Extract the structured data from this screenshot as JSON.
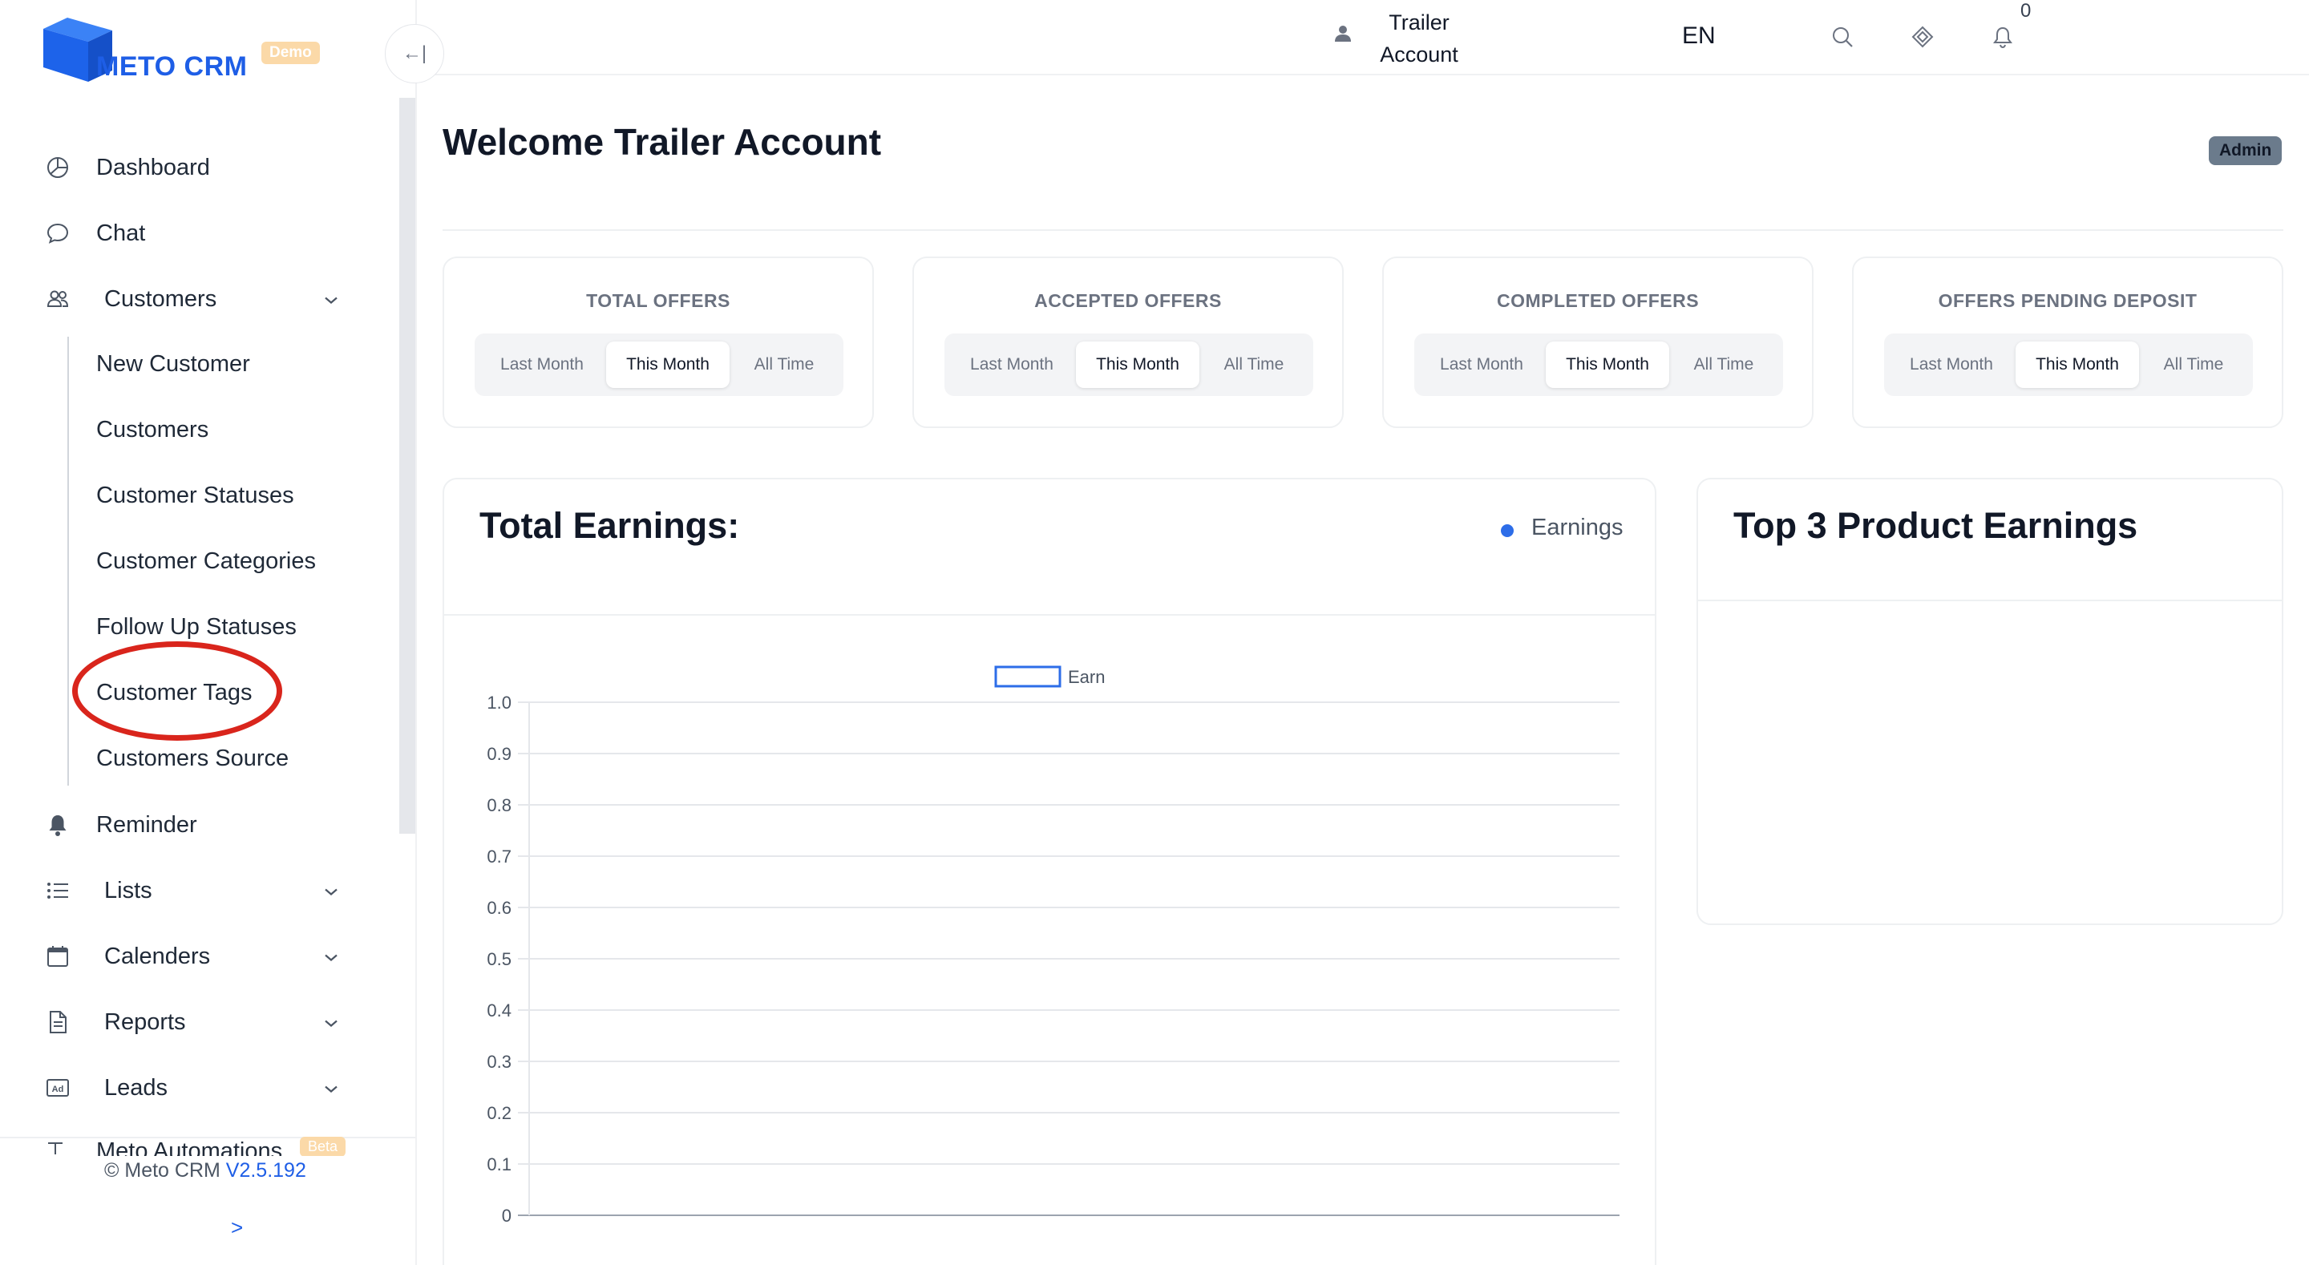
{
  "brand": {
    "name": "METO CRM",
    "badge": "Demo"
  },
  "sidebar": {
    "items": [
      {
        "label": "Dashboard",
        "icon": "pie-chart-icon"
      },
      {
        "label": "Chat",
        "icon": "chat-bubble-icon"
      },
      {
        "label": "Customers",
        "icon": "users-icon",
        "expanded": true
      },
      {
        "label": "Reminder",
        "icon": "bell-filled-icon"
      },
      {
        "label": "Lists",
        "icon": "list-icon"
      },
      {
        "label": "Calenders",
        "icon": "calendar-icon"
      },
      {
        "label": "Reports",
        "icon": "document-icon"
      },
      {
        "label": "Leads",
        "icon": "ad-icon"
      }
    ],
    "customers_sub": [
      "New Customer",
      "Customers",
      "Customer Statuses",
      "Customer Categories",
      "Follow Up Statuses",
      "Customer Tags",
      "Customers Source"
    ],
    "automations": {
      "label": "Meto Automations",
      "badge": "Beta"
    },
    "footer": {
      "copyright": "© Meto CRM",
      "version": "V2.5.192",
      "expand": ">"
    },
    "collapse": "←|"
  },
  "header": {
    "notifications_count": "0",
    "language": "EN",
    "user_line1": "Trailer",
    "user_line2": "Account"
  },
  "main": {
    "welcome": "Welcome Trailer Account",
    "role_badge": "Admin",
    "stat_cards": [
      {
        "title": "TOTAL OFFERS"
      },
      {
        "title": "ACCEPTED OFFERS"
      },
      {
        "title": "COMPLETED OFFERS"
      },
      {
        "title": "OFFERS PENDING DEPOSIT"
      }
    ],
    "period_options": [
      "Last Month",
      "This Month",
      "All Time"
    ],
    "selected_period": "This Month",
    "earnings": {
      "title": "Total Earnings:",
      "legend": "Earnings"
    },
    "top3": {
      "title": "Top 3 Product Earnings"
    }
  },
  "colors": {
    "accent": "#1e5ee6",
    "highlight": "#d9251c",
    "admin_badge": "#6b7b8c"
  },
  "chart_data": {
    "type": "bar",
    "title": "",
    "series": [
      {
        "name": "Earn",
        "values": []
      }
    ],
    "categories": [],
    "ylim": [
      0,
      1
    ],
    "yticks": [
      "1.0",
      "0.9",
      "0.8",
      "0.7",
      "0.6",
      "0.5",
      "0.4",
      "0.3",
      "0.2",
      "0.1",
      "0"
    ],
    "grid": true,
    "legend": "top-center"
  }
}
